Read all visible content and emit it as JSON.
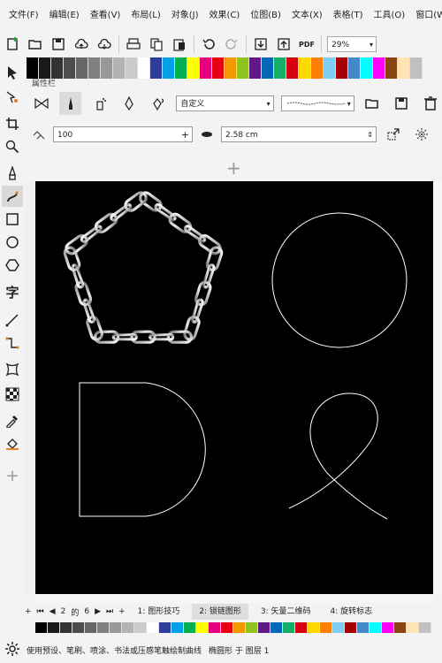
{
  "menu": {
    "items": [
      "文件(F)",
      "编辑(E)",
      "查看(V)",
      "布局(L)",
      "对象(J)",
      "效果(C)",
      "位图(B)",
      "文本(X)",
      "表格(T)",
      "工具(O)",
      "窗口(W)"
    ]
  },
  "toolbar": {
    "icons": [
      "new-icon",
      "open-icon",
      "save-icon",
      "cloud-upload-icon",
      "cloud-download-icon",
      "print-icon",
      "undo-icon",
      "redo-icon",
      "import-icon",
      "export-icon",
      "pdf-icon"
    ],
    "pdf_label": "PDF",
    "zoom_value": "29%"
  },
  "property_bar": {
    "title": "属性栏",
    "preset_value": "自定义",
    "stroke_size_value": "100",
    "width_value": "2.58 cm"
  },
  "page_nav": {
    "page_current": "2",
    "page_of": "的",
    "page_total": "6",
    "tabs": [
      "1: 图形技巧",
      "2: 锁链图形",
      "3: 矢量二维码",
      "4: 旋转标志"
    ]
  },
  "status": {
    "hint": "使用预设、笔刷、喷涂、书法或压感笔触绘制曲线",
    "object_info": "椭圆形 于 图层 1"
  },
  "colors": {
    "palette": [
      "#000000",
      "#1a1a1a",
      "#333333",
      "#4d4d4d",
      "#666666",
      "#808080",
      "#999999",
      "#b3b3b3",
      "#cccccc",
      "#ffffff",
      "#2f3d9a",
      "#00a0e9",
      "#00b050",
      "#ffff00",
      "#e4007f",
      "#e60012",
      "#f39800",
      "#8fc31f",
      "#601986",
      "#0068b7",
      "#13ae67",
      "#d7000f",
      "#ffd800",
      "#ff7f00",
      "#7ecef4",
      "#a40000",
      "#448aca",
      "#00ffff",
      "#ff00ff",
      "#8b4513",
      "#ffe4b5",
      "#c0c0c0"
    ],
    "canvas_bg": "#000000"
  }
}
